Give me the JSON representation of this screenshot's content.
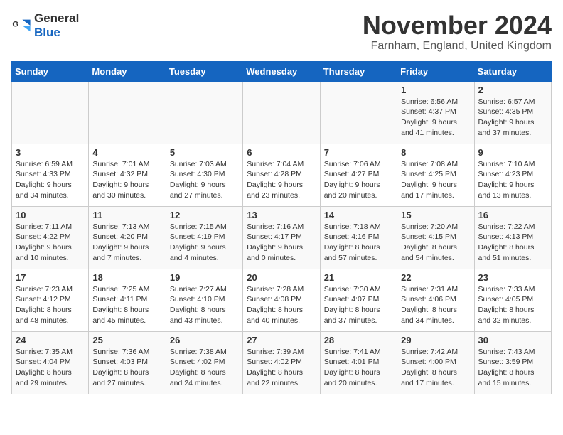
{
  "logo": {
    "general": "General",
    "blue": "Blue"
  },
  "title": "November 2024",
  "location": "Farnham, England, United Kingdom",
  "days_of_week": [
    "Sunday",
    "Monday",
    "Tuesday",
    "Wednesday",
    "Thursday",
    "Friday",
    "Saturday"
  ],
  "weeks": [
    [
      {
        "day": "",
        "info": ""
      },
      {
        "day": "",
        "info": ""
      },
      {
        "day": "",
        "info": ""
      },
      {
        "day": "",
        "info": ""
      },
      {
        "day": "",
        "info": ""
      },
      {
        "day": "1",
        "info": "Sunrise: 6:56 AM\nSunset: 4:37 PM\nDaylight: 9 hours and 41 minutes."
      },
      {
        "day": "2",
        "info": "Sunrise: 6:57 AM\nSunset: 4:35 PM\nDaylight: 9 hours and 37 minutes."
      }
    ],
    [
      {
        "day": "3",
        "info": "Sunrise: 6:59 AM\nSunset: 4:33 PM\nDaylight: 9 hours and 34 minutes."
      },
      {
        "day": "4",
        "info": "Sunrise: 7:01 AM\nSunset: 4:32 PM\nDaylight: 9 hours and 30 minutes."
      },
      {
        "day": "5",
        "info": "Sunrise: 7:03 AM\nSunset: 4:30 PM\nDaylight: 9 hours and 27 minutes."
      },
      {
        "day": "6",
        "info": "Sunrise: 7:04 AM\nSunset: 4:28 PM\nDaylight: 9 hours and 23 minutes."
      },
      {
        "day": "7",
        "info": "Sunrise: 7:06 AM\nSunset: 4:27 PM\nDaylight: 9 hours and 20 minutes."
      },
      {
        "day": "8",
        "info": "Sunrise: 7:08 AM\nSunset: 4:25 PM\nDaylight: 9 hours and 17 minutes."
      },
      {
        "day": "9",
        "info": "Sunrise: 7:10 AM\nSunset: 4:23 PM\nDaylight: 9 hours and 13 minutes."
      }
    ],
    [
      {
        "day": "10",
        "info": "Sunrise: 7:11 AM\nSunset: 4:22 PM\nDaylight: 9 hours and 10 minutes."
      },
      {
        "day": "11",
        "info": "Sunrise: 7:13 AM\nSunset: 4:20 PM\nDaylight: 9 hours and 7 minutes."
      },
      {
        "day": "12",
        "info": "Sunrise: 7:15 AM\nSunset: 4:19 PM\nDaylight: 9 hours and 4 minutes."
      },
      {
        "day": "13",
        "info": "Sunrise: 7:16 AM\nSunset: 4:17 PM\nDaylight: 9 hours and 0 minutes."
      },
      {
        "day": "14",
        "info": "Sunrise: 7:18 AM\nSunset: 4:16 PM\nDaylight: 8 hours and 57 minutes."
      },
      {
        "day": "15",
        "info": "Sunrise: 7:20 AM\nSunset: 4:15 PM\nDaylight: 8 hours and 54 minutes."
      },
      {
        "day": "16",
        "info": "Sunrise: 7:22 AM\nSunset: 4:13 PM\nDaylight: 8 hours and 51 minutes."
      }
    ],
    [
      {
        "day": "17",
        "info": "Sunrise: 7:23 AM\nSunset: 4:12 PM\nDaylight: 8 hours and 48 minutes."
      },
      {
        "day": "18",
        "info": "Sunrise: 7:25 AM\nSunset: 4:11 PM\nDaylight: 8 hours and 45 minutes."
      },
      {
        "day": "19",
        "info": "Sunrise: 7:27 AM\nSunset: 4:10 PM\nDaylight: 8 hours and 43 minutes."
      },
      {
        "day": "20",
        "info": "Sunrise: 7:28 AM\nSunset: 4:08 PM\nDaylight: 8 hours and 40 minutes."
      },
      {
        "day": "21",
        "info": "Sunrise: 7:30 AM\nSunset: 4:07 PM\nDaylight: 8 hours and 37 minutes."
      },
      {
        "day": "22",
        "info": "Sunrise: 7:31 AM\nSunset: 4:06 PM\nDaylight: 8 hours and 34 minutes."
      },
      {
        "day": "23",
        "info": "Sunrise: 7:33 AM\nSunset: 4:05 PM\nDaylight: 8 hours and 32 minutes."
      }
    ],
    [
      {
        "day": "24",
        "info": "Sunrise: 7:35 AM\nSunset: 4:04 PM\nDaylight: 8 hours and 29 minutes."
      },
      {
        "day": "25",
        "info": "Sunrise: 7:36 AM\nSunset: 4:03 PM\nDaylight: 8 hours and 27 minutes."
      },
      {
        "day": "26",
        "info": "Sunrise: 7:38 AM\nSunset: 4:02 PM\nDaylight: 8 hours and 24 minutes."
      },
      {
        "day": "27",
        "info": "Sunrise: 7:39 AM\nSunset: 4:02 PM\nDaylight: 8 hours and 22 minutes."
      },
      {
        "day": "28",
        "info": "Sunrise: 7:41 AM\nSunset: 4:01 PM\nDaylight: 8 hours and 20 minutes."
      },
      {
        "day": "29",
        "info": "Sunrise: 7:42 AM\nSunset: 4:00 PM\nDaylight: 8 hours and 17 minutes."
      },
      {
        "day": "30",
        "info": "Sunrise: 7:43 AM\nSunset: 3:59 PM\nDaylight: 8 hours and 15 minutes."
      }
    ]
  ]
}
